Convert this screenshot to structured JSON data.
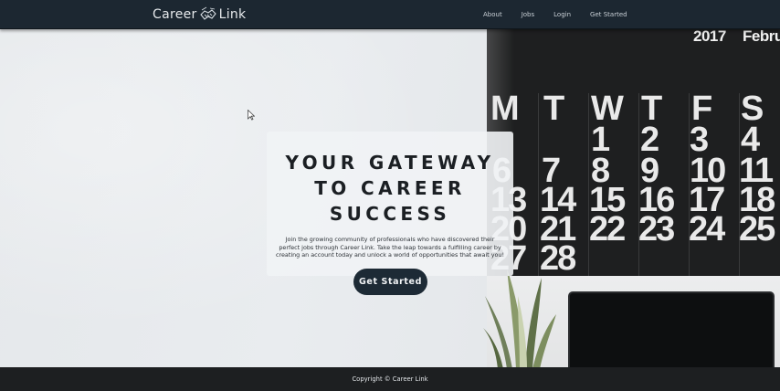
{
  "navbar": {
    "brand_left": "Career",
    "brand_right": "Link",
    "brand_icon": "handshake-icon",
    "links": [
      {
        "label": "About"
      },
      {
        "label": "Jobs"
      },
      {
        "label": "Login"
      },
      {
        "label": "Get Started"
      }
    ]
  },
  "hero": {
    "headline": "YOUR GATEWAY TO CAREER SUCCESS",
    "description": "Join the growing community of professionals who have discovered their perfect jobs through Career Link. Take the leap towards a fulfilling career by creating an account today and unlock a world of opportunities that await you!",
    "cta_label": "Get Started"
  },
  "calendar": {
    "year": "2017",
    "month": "Febru",
    "days": [
      "M",
      "T",
      "W",
      "T",
      "F",
      "S"
    ],
    "numbers": [
      "1",
      "2",
      "3",
      "4",
      "6",
      "7",
      "8",
      "9",
      "10",
      "11",
      "13",
      "14",
      "15",
      "16",
      "17",
      "18",
      "20",
      "21",
      "22",
      "23",
      "24",
      "25",
      "27",
      "28"
    ]
  },
  "footer": {
    "copyright": "Copyright © Career Link"
  },
  "colors": {
    "navbar_bg": "#1c2731",
    "cta_bg": "#1d2a35",
    "footer_bg": "#1d1f21",
    "calendar_bg": "#1e1f20"
  }
}
